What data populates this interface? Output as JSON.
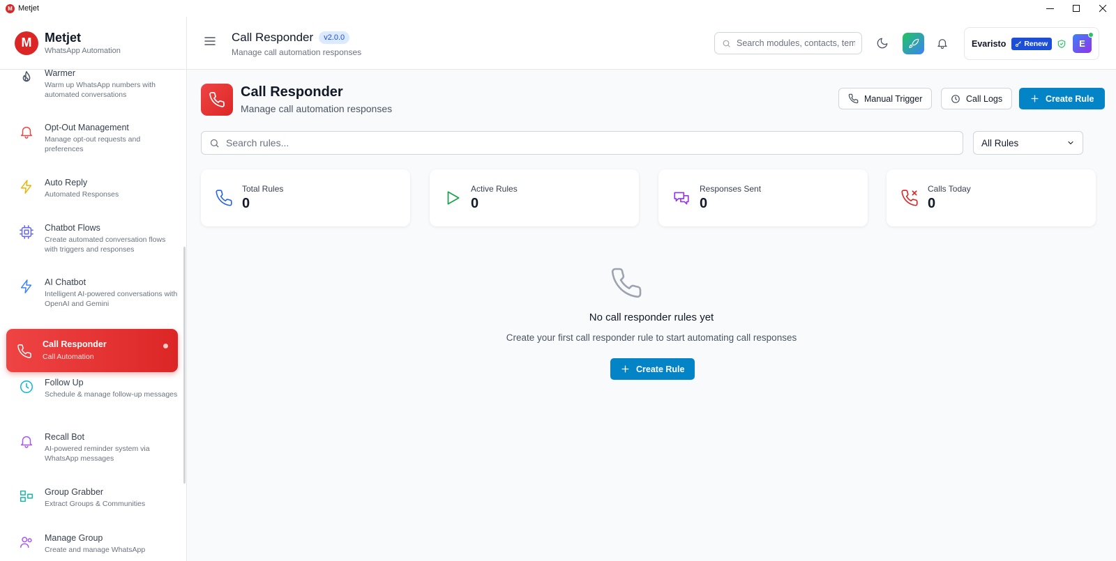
{
  "window": {
    "title": "Metjet",
    "app_icon_letter": "M"
  },
  "brand": {
    "logo_letter": "M",
    "name": "Metjet",
    "subtitle": "WhatsApp Automation"
  },
  "sidebar": {
    "items": [
      {
        "title": "Warmer",
        "desc": "Warm up WhatsApp numbers with automated conversations",
        "icon": "flame-icon"
      },
      {
        "title": "Opt-Out Management",
        "desc": "Manage opt-out requests and preferences",
        "icon": "bell-icon"
      },
      {
        "title": "Auto Reply",
        "desc": "Automated Responses",
        "icon": "lightning-icon"
      },
      {
        "title": "Chatbot Flows",
        "desc": "Create automated conversation flows with triggers and responses",
        "icon": "cpu-icon"
      },
      {
        "title": "AI Chatbot",
        "desc": "Intelligent AI-powered conversations with OpenAI and Gemini",
        "icon": "lightning-icon"
      },
      {
        "title": "Call Responder",
        "desc": "Call Automation",
        "icon": "phone-icon",
        "active": true
      },
      {
        "title": "Follow Up",
        "desc": "Schedule & manage follow-up messages",
        "icon": "clock-icon"
      },
      {
        "title": "Recall Bot",
        "desc": "AI-powered reminder system via WhatsApp messages",
        "icon": "bell-icon"
      },
      {
        "title": "Group Grabber",
        "desc": "Extract Groups & Communities",
        "icon": "group-grid-icon"
      },
      {
        "title": "Manage Group",
        "desc": "Create and manage WhatsApp",
        "icon": "users-icon"
      }
    ]
  },
  "header": {
    "title": "Call Responder",
    "version": "v2.0.0",
    "subtitle": "Manage call automation responses",
    "search_placeholder": "Search modules, contacts, templates...",
    "user_name": "Evaristo",
    "renew_label": "Renew",
    "avatar_letter": "E"
  },
  "page": {
    "title": "Call Responder",
    "subtitle": "Manage call automation responses",
    "manual_trigger_label": "Manual Trigger",
    "call_logs_label": "Call Logs",
    "create_rule_label": "Create Rule",
    "search_placeholder": "Search rules...",
    "filter_selected": "All Rules"
  },
  "stats": [
    {
      "label": "Total Rules",
      "value": "0",
      "color": "#2563eb"
    },
    {
      "label": "Active Rules",
      "value": "0",
      "color": "#16a34a"
    },
    {
      "label": "Responses Sent",
      "value": "0",
      "color": "#9333ea"
    },
    {
      "label": "Calls Today",
      "value": "0",
      "color": "#dc2626"
    }
  ],
  "empty_state": {
    "title": "No call responder rules yet",
    "subtitle": "Create your first call responder rule to start automating call responses",
    "button_label": "Create Rule"
  },
  "colors": {
    "accent_red": "#dc2626",
    "primary_blue": "#0284c7",
    "renew_blue": "#1d4ed8"
  }
}
